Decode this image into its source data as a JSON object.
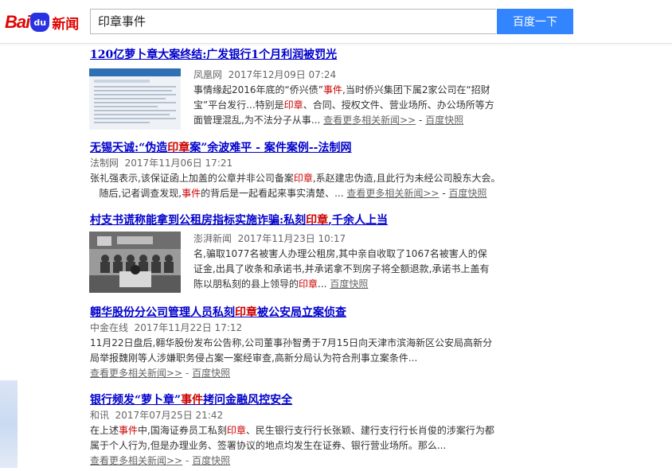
{
  "header": {
    "logo_text": "Bai",
    "logo_paw": "du",
    "logo_news": "新闻",
    "search_value": "印章事件",
    "search_button": "百度一下"
  },
  "results": [
    {
      "title_parts": [
        "120亿萝卜章大案终结:广发银行1个月利润被罚光"
      ],
      "source": "凤凰网",
      "time": "2017年12月09日 07:24",
      "body_html": "事情缘起2016年底的“侨兴债”<em>事件</em>,当时侨兴集团下属2家公司在“招财宝”平台发行...特别是<em>印章</em>、合同、授权文件、营业场所、办公场所等方面管理混乱,为不法分子从事...",
      "more": "查看更多相关新闻>>",
      "snapshot": "百度快照"
    },
    {
      "title_html": "无锡天诚:“伪造<em>印章</em>案”余波难平 - 案件案例--法制网",
      "source": "法制网",
      "time": "2017年11月06日 17:21",
      "body_html": "张礼强表示,该保证函上加盖的公章并非公司备案<em>印章</em>,系赵建忠伪造,且此行为未经公司股东大会。<br>&nbsp;&nbsp;&nbsp;随后,记者调查发现,<em>事件</em>的背后是一起看起来事实清楚、...",
      "more": "查看更多相关新闻>>",
      "snapshot": "百度快照"
    },
    {
      "title_html": "村支书谎称能拿到公租房指标实施诈骗:私刻<em>印章</em>,千余人上当",
      "source": "澎湃新闻",
      "time": "2017年11月23日 10:17",
      "body_html": "名,骗取1077名被害人办理公租房,其中亲自收取了1067名被害人的保证金,出具了收条和承诺书,并承诺拿不到房子将全额退款,承诺书上盖有陈以朋私刻的县上领导的<em>印章</em>...",
      "snapshot": "百度快照"
    },
    {
      "title_html": "翱华股份分公司管理人员私刻<em>印章</em>被公安局立案侦查",
      "source": "中金在线",
      "time": "2017年11月22日 17:12",
      "body_html": "11月22日盘后,翱华股份发布公告称,公司董事孙智勇于7月15日向天津市滨海新区公安局高新分局举报魏刚等人涉嫌职务侵占案一案经审查,高新分局认为符合刑事立案条件...",
      "more": "查看更多相关新闻>>",
      "snapshot": "百度快照"
    },
    {
      "title_html": "银行频发“萝卜章”<em>事件</em>拷问金融风控安全",
      "source": "和讯",
      "time": "2017年07月25日 21:42",
      "body_html": "在上述<em>事件</em>中,国海证券员工私刻<em>印章</em>、民生银行支行行长张颖、建行支行行长肖俊的涉案行为都属于个人行为,但是办理业务、签署协议的地点均发生在证券、银行营业场所。那么...",
      "more": "查看更多相关新闻>>",
      "snapshot": "百度快照"
    }
  ],
  "separator": " - "
}
